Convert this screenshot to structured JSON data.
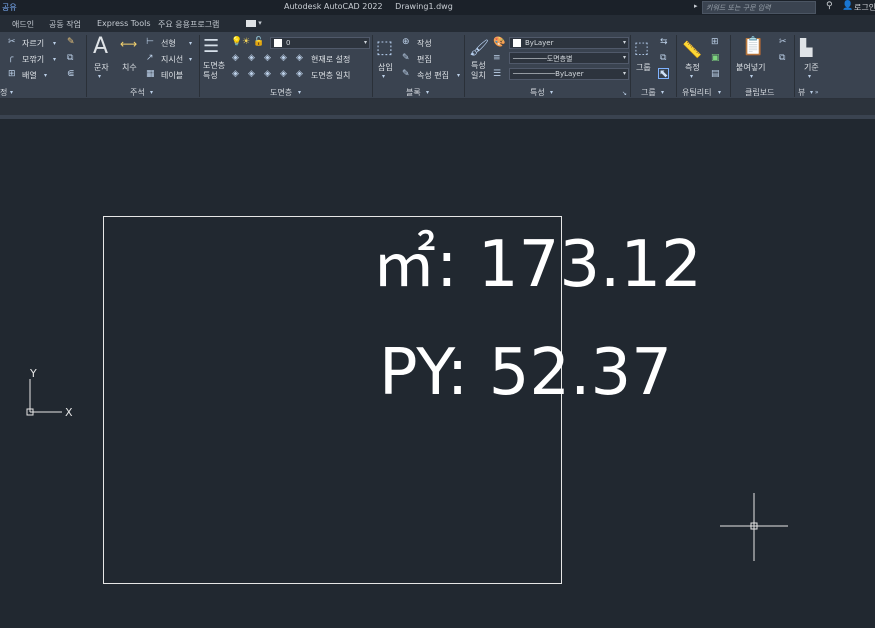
{
  "titlebar": {
    "share_label": "공유",
    "app_name": "Autodesk AutoCAD 2022",
    "file_name": "Drawing1.dwg",
    "search_placeholder": "키워드 또는 구문 입력",
    "login_label": "로그인"
  },
  "tabs": [
    {
      "label": "애드인"
    },
    {
      "label": "공동 작업"
    },
    {
      "label": "Express Tools"
    },
    {
      "label": "주요 응용프로그램"
    }
  ],
  "ribbon": {
    "modify": {
      "title": "정",
      "trim_label": "자르기",
      "fillet_label": "모깎기",
      "array_label": "배열"
    },
    "annotation": {
      "title": "주석",
      "text_label": "문자",
      "dimension_label": "치수",
      "linear_label": "선형",
      "leader_label": "지시선",
      "table_label": "테이블"
    },
    "layers": {
      "title": "도면층",
      "layer_props_label": "도면층\n특성",
      "current_layer": "0",
      "make_current_label": "현재로 설정",
      "match_layer_label": "도면층 일치"
    },
    "block": {
      "title": "블록",
      "insert_label": "삽입",
      "create_label": "작성",
      "edit_label": "편집",
      "attr_edit_label": "속성 편집"
    },
    "properties": {
      "title": "특성",
      "match_props_label": "특성\n일치",
      "color_value": "ByLayer",
      "linetype_value": "도면층별",
      "lineweight_value": "ByLayer"
    },
    "groups": {
      "title": "그룹",
      "group_label": "그룹"
    },
    "utilities": {
      "title": "유틸리티",
      "measure_label": "측정"
    },
    "clipboard": {
      "title": "클립보드",
      "paste_label": "붙여넣기"
    },
    "view": {
      "title": "뷰",
      "base_label": "기준"
    }
  },
  "canvas": {
    "area_text": "㎡: 173.12",
    "py_text": "PY: 52.37",
    "ucs_x_label": "X",
    "ucs_y_label": "Y"
  },
  "colors": {
    "background": "#212830",
    "ribbon": "#3a4350",
    "geometry": "#e6e6e6",
    "text": "#ffffff"
  }
}
